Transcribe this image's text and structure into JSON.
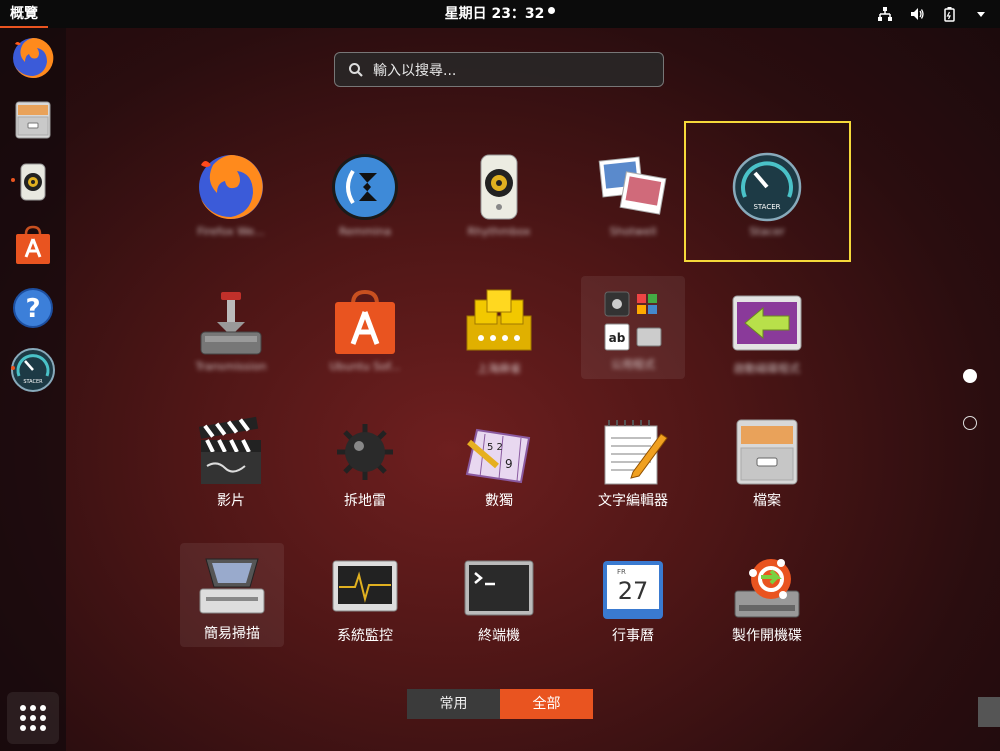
{
  "topbar": {
    "activities_label": "概覽",
    "clock_text": "星期日 23：32",
    "tray_icons": [
      "network-icon",
      "volume-icon",
      "battery-icon",
      "chevron-down-icon"
    ]
  },
  "dock": {
    "items": [
      {
        "name": "firefox",
        "icon": "firefox-icon"
      },
      {
        "name": "files",
        "icon": "file-cabinet-icon"
      },
      {
        "name": "rhythmbox",
        "icon": "speaker-icon"
      },
      {
        "name": "ubuntu-software",
        "icon": "shopping-bag-icon"
      },
      {
        "name": "help",
        "icon": "help-icon"
      },
      {
        "name": "stacer",
        "icon": "gauge-icon"
      }
    ],
    "show_apps_icon": "grid-icon"
  },
  "search": {
    "placeholder": "輸入以搜尋..."
  },
  "apps": [
    {
      "id": "firefox",
      "label": "Firefox We...",
      "blurred": true,
      "icon": "firefox-icon"
    },
    {
      "id": "remmina",
      "label": "Remmina",
      "blurred": true,
      "icon": "remmina-icon"
    },
    {
      "id": "rhythmbox",
      "label": "Rhythmbox",
      "blurred": true,
      "icon": "speaker-icon"
    },
    {
      "id": "shotwell",
      "label": "Shotwell",
      "blurred": true,
      "icon": "photos-icon"
    },
    {
      "id": "stacer",
      "label": "Stacer",
      "blurred": true,
      "icon": "gauge-icon",
      "selected": true
    },
    {
      "id": "transmission",
      "label": "Transmission",
      "blurred": true,
      "icon": "transmission-icon"
    },
    {
      "id": "ubuntu-software",
      "label": "Ubuntu Sof...",
      "blurred": true,
      "icon": "shopping-bag-icon"
    },
    {
      "id": "mahjongg",
      "label": "上海麻雀",
      "blurred": true,
      "icon": "mahjong-icon"
    },
    {
      "id": "utilities",
      "label": "公用程式",
      "blurred": true,
      "icon": "folder-grid-icon"
    },
    {
      "id": "startup-disk",
      "label": "啟動磁碟程式",
      "blurred": true,
      "icon": "arrow-left-icon"
    },
    {
      "id": "videos",
      "label": "影片",
      "blurred": false,
      "icon": "clapperboard-icon"
    },
    {
      "id": "mines",
      "label": "拆地雷",
      "blurred": false,
      "icon": "mine-icon"
    },
    {
      "id": "sudoku",
      "label": "數獨",
      "blurred": false,
      "icon": "sudoku-icon"
    },
    {
      "id": "text-editor",
      "label": "文字編輯器",
      "blurred": false,
      "icon": "notepad-icon"
    },
    {
      "id": "files",
      "label": "檔案",
      "blurred": false,
      "icon": "file-cabinet-icon"
    },
    {
      "id": "simple-scan",
      "label": "簡易掃描",
      "blurred": false,
      "icon": "scanner-icon"
    },
    {
      "id": "system-monitor",
      "label": "系統監控",
      "blurred": false,
      "icon": "monitor-icon"
    },
    {
      "id": "terminal",
      "label": "終端機",
      "blurred": false,
      "icon": "terminal-icon"
    },
    {
      "id": "calendar",
      "label": "行事曆",
      "blurred": false,
      "icon": "calendar-icon",
      "calendar_month": "FR",
      "calendar_day": "27"
    },
    {
      "id": "usb-creator",
      "label": "製作開機碟",
      "blurred": false,
      "icon": "usb-creator-icon"
    }
  ],
  "pager": {
    "pages": 2,
    "current": 1
  },
  "view_switch": {
    "frequent_label": "常用",
    "all_label": "全部",
    "active": "all"
  },
  "colors": {
    "accent": "#e95420",
    "selection_frame": "#f5d93a"
  }
}
